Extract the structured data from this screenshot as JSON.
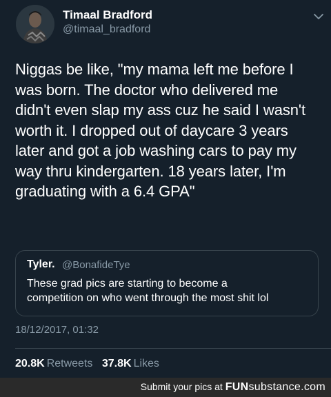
{
  "tweet": {
    "author_name": "Timaal Bradford",
    "author_handle": "@timaal_bradford",
    "text": "Niggas be like, \"my mama left me before I\nwas born. The doctor who delivered me\ndidn't even slap my ass cuz he said I wasn't\nworth it. I dropped out of daycare 3 years\nlater and got a job washing cars to pay my\nway thru kindergarten. 18 years later, I'm\ngraduating with a 6.4 GPA\"",
    "quoted": {
      "author_name": "Tyler.",
      "author_handle": "@BonafideTye",
      "text": "These grad pics are starting to become a\ncompetition on who went through the most shit lol"
    },
    "timestamp": "18/12/2017, 01:32",
    "retweets_count": "20.8K",
    "retweets_label": "Retweets",
    "likes_count": "37.8K",
    "likes_label": "Likes"
  },
  "footer": {
    "text": "Submit your pics at",
    "brand_fun": "FUN",
    "brand_sub": "substance",
    "brand_tld": ".com"
  },
  "colors": {
    "background": "#15202b",
    "secondary_text": "#8899a6",
    "divider": "#38444d"
  }
}
